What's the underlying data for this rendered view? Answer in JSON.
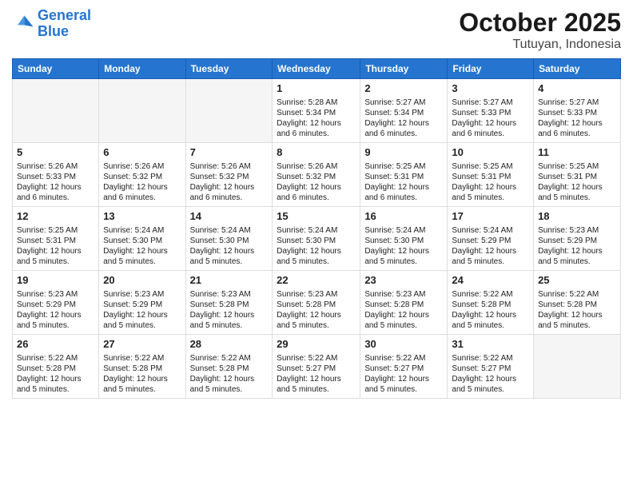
{
  "logo": {
    "line1": "General",
    "line2": "Blue"
  },
  "title": "October 2025",
  "location": "Tutuyan, Indonesia",
  "weekdays": [
    "Sunday",
    "Monday",
    "Tuesday",
    "Wednesday",
    "Thursday",
    "Friday",
    "Saturday"
  ],
  "weeks": [
    [
      {
        "day": "",
        "info": ""
      },
      {
        "day": "",
        "info": ""
      },
      {
        "day": "",
        "info": ""
      },
      {
        "day": "1",
        "info": "Sunrise: 5:28 AM\nSunset: 5:34 PM\nDaylight: 12 hours\nand 6 minutes."
      },
      {
        "day": "2",
        "info": "Sunrise: 5:27 AM\nSunset: 5:34 PM\nDaylight: 12 hours\nand 6 minutes."
      },
      {
        "day": "3",
        "info": "Sunrise: 5:27 AM\nSunset: 5:33 PM\nDaylight: 12 hours\nand 6 minutes."
      },
      {
        "day": "4",
        "info": "Sunrise: 5:27 AM\nSunset: 5:33 PM\nDaylight: 12 hours\nand 6 minutes."
      }
    ],
    [
      {
        "day": "5",
        "info": "Sunrise: 5:26 AM\nSunset: 5:33 PM\nDaylight: 12 hours\nand 6 minutes."
      },
      {
        "day": "6",
        "info": "Sunrise: 5:26 AM\nSunset: 5:32 PM\nDaylight: 12 hours\nand 6 minutes."
      },
      {
        "day": "7",
        "info": "Sunrise: 5:26 AM\nSunset: 5:32 PM\nDaylight: 12 hours\nand 6 minutes."
      },
      {
        "day": "8",
        "info": "Sunrise: 5:26 AM\nSunset: 5:32 PM\nDaylight: 12 hours\nand 6 minutes."
      },
      {
        "day": "9",
        "info": "Sunrise: 5:25 AM\nSunset: 5:31 PM\nDaylight: 12 hours\nand 6 minutes."
      },
      {
        "day": "10",
        "info": "Sunrise: 5:25 AM\nSunset: 5:31 PM\nDaylight: 12 hours\nand 5 minutes."
      },
      {
        "day": "11",
        "info": "Sunrise: 5:25 AM\nSunset: 5:31 PM\nDaylight: 12 hours\nand 5 minutes."
      }
    ],
    [
      {
        "day": "12",
        "info": "Sunrise: 5:25 AM\nSunset: 5:31 PM\nDaylight: 12 hours\nand 5 minutes."
      },
      {
        "day": "13",
        "info": "Sunrise: 5:24 AM\nSunset: 5:30 PM\nDaylight: 12 hours\nand 5 minutes."
      },
      {
        "day": "14",
        "info": "Sunrise: 5:24 AM\nSunset: 5:30 PM\nDaylight: 12 hours\nand 5 minutes."
      },
      {
        "day": "15",
        "info": "Sunrise: 5:24 AM\nSunset: 5:30 PM\nDaylight: 12 hours\nand 5 minutes."
      },
      {
        "day": "16",
        "info": "Sunrise: 5:24 AM\nSunset: 5:30 PM\nDaylight: 12 hours\nand 5 minutes."
      },
      {
        "day": "17",
        "info": "Sunrise: 5:24 AM\nSunset: 5:29 PM\nDaylight: 12 hours\nand 5 minutes."
      },
      {
        "day": "18",
        "info": "Sunrise: 5:23 AM\nSunset: 5:29 PM\nDaylight: 12 hours\nand 5 minutes."
      }
    ],
    [
      {
        "day": "19",
        "info": "Sunrise: 5:23 AM\nSunset: 5:29 PM\nDaylight: 12 hours\nand 5 minutes."
      },
      {
        "day": "20",
        "info": "Sunrise: 5:23 AM\nSunset: 5:29 PM\nDaylight: 12 hours\nand 5 minutes."
      },
      {
        "day": "21",
        "info": "Sunrise: 5:23 AM\nSunset: 5:28 PM\nDaylight: 12 hours\nand 5 minutes."
      },
      {
        "day": "22",
        "info": "Sunrise: 5:23 AM\nSunset: 5:28 PM\nDaylight: 12 hours\nand 5 minutes."
      },
      {
        "day": "23",
        "info": "Sunrise: 5:23 AM\nSunset: 5:28 PM\nDaylight: 12 hours\nand 5 minutes."
      },
      {
        "day": "24",
        "info": "Sunrise: 5:22 AM\nSunset: 5:28 PM\nDaylight: 12 hours\nand 5 minutes."
      },
      {
        "day": "25",
        "info": "Sunrise: 5:22 AM\nSunset: 5:28 PM\nDaylight: 12 hours\nand 5 minutes."
      }
    ],
    [
      {
        "day": "26",
        "info": "Sunrise: 5:22 AM\nSunset: 5:28 PM\nDaylight: 12 hours\nand 5 minutes."
      },
      {
        "day": "27",
        "info": "Sunrise: 5:22 AM\nSunset: 5:28 PM\nDaylight: 12 hours\nand 5 minutes."
      },
      {
        "day": "28",
        "info": "Sunrise: 5:22 AM\nSunset: 5:28 PM\nDaylight: 12 hours\nand 5 minutes."
      },
      {
        "day": "29",
        "info": "Sunrise: 5:22 AM\nSunset: 5:27 PM\nDaylight: 12 hours\nand 5 minutes."
      },
      {
        "day": "30",
        "info": "Sunrise: 5:22 AM\nSunset: 5:27 PM\nDaylight: 12 hours\nand 5 minutes."
      },
      {
        "day": "31",
        "info": "Sunrise: 5:22 AM\nSunset: 5:27 PM\nDaylight: 12 hours\nand 5 minutes."
      },
      {
        "day": "",
        "info": ""
      }
    ]
  ]
}
